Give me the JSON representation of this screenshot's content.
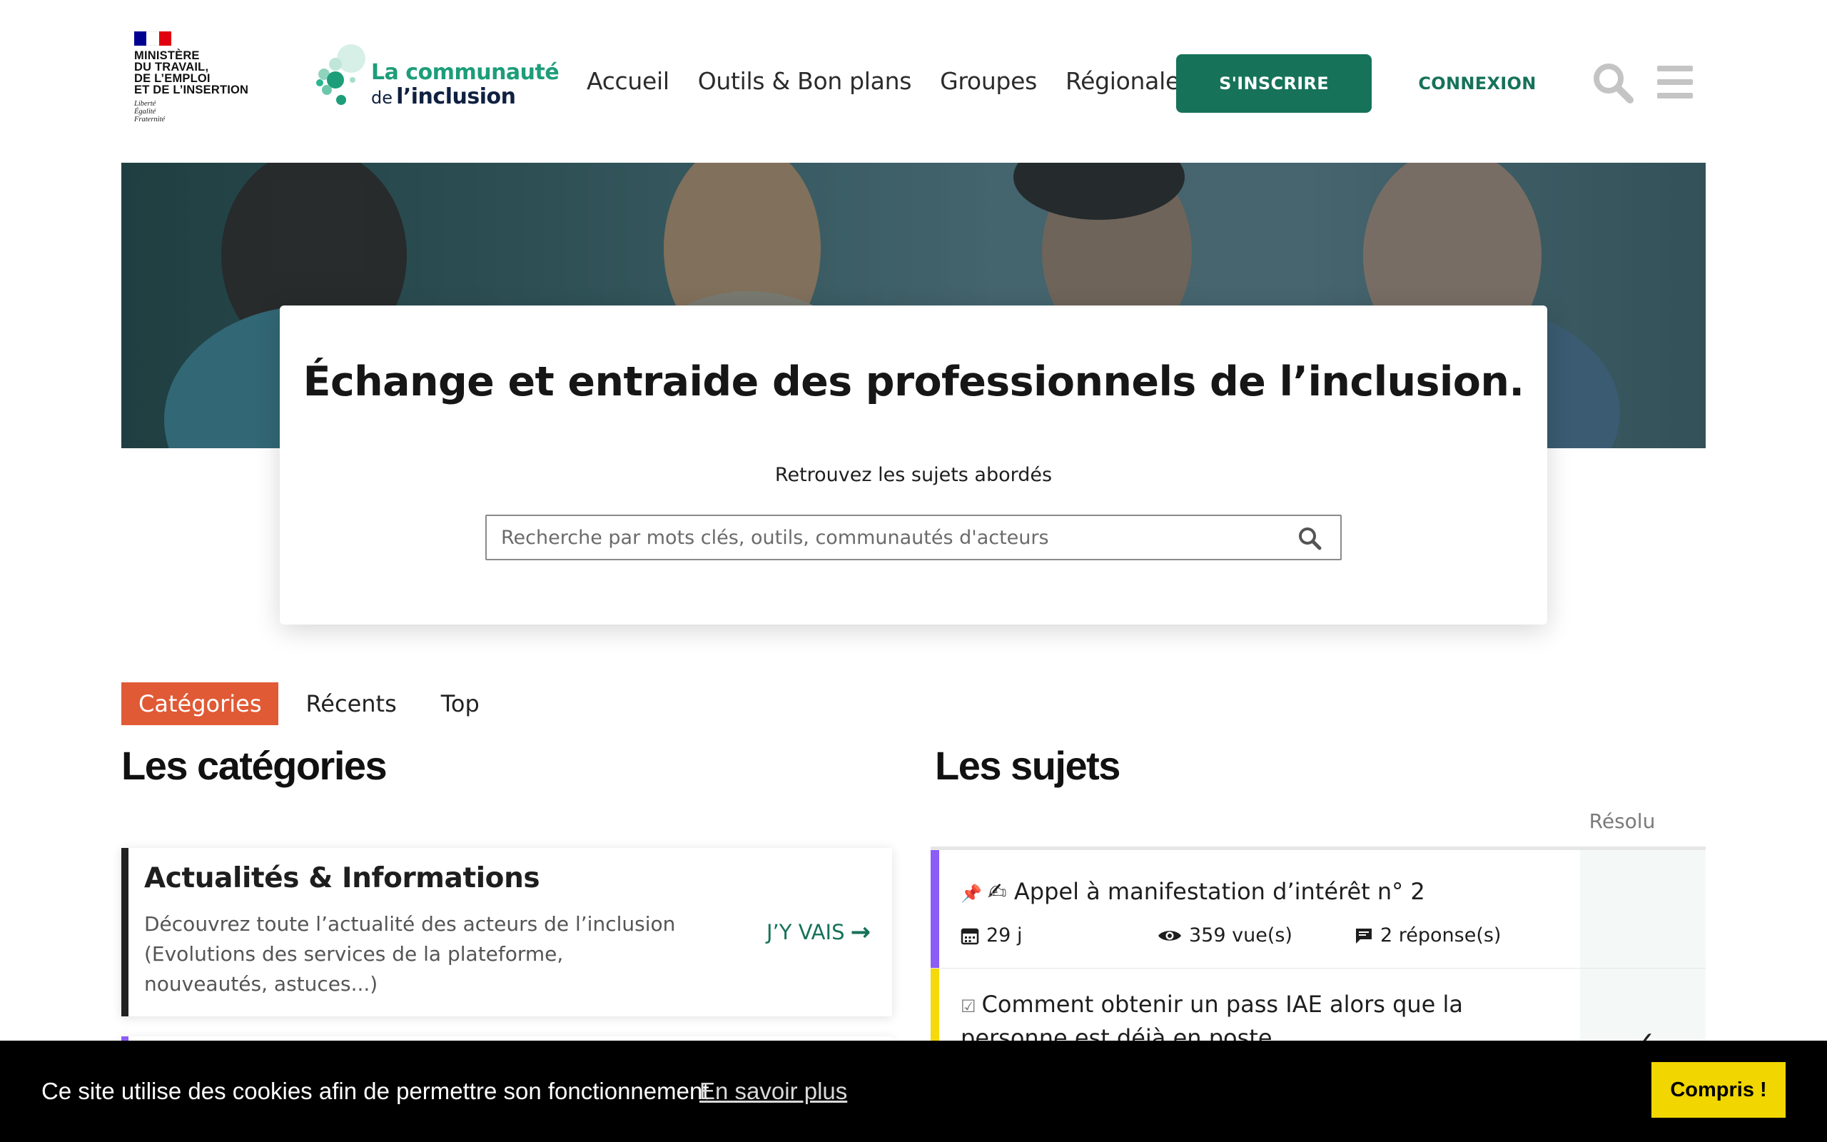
{
  "gov": {
    "lines": [
      "MINISTÈRE",
      "DU TRAVAIL,",
      "DE L’EMPLOI",
      "ET DE L’INSERTION"
    ],
    "motto": [
      "Liberté",
      "Égalité",
      "Fraternité"
    ]
  },
  "brand": {
    "line1": "La communauté",
    "line2_small": "de",
    "line2_big": "l’inclusion"
  },
  "nav": {
    "items": [
      "Accueil",
      "Outils & Bon plans",
      "Groupes",
      "Régionales"
    ],
    "signup": "S'INSCRIRE",
    "login": "CONNEXION"
  },
  "hero": {
    "title_regular": "Échange et entraide ",
    "title_bold": "des professionnels de l’inclusion",
    "title_end": ".",
    "subtitle": "Retrouvez les sujets abordés",
    "search_placeholder": "Recherche par mots clés, outils, communautés d'acteurs"
  },
  "tabs": [
    "Catégories",
    "Récents",
    "Top"
  ],
  "categories": {
    "heading": "Les catégories",
    "items": [
      {
        "title": "Actualités & Informations",
        "description": "Découvrez toute l’actualité des acteurs de l’inclusion (Evolutions des services de la plateforme, nouveautés, astuces...)",
        "link": "J’Y VAIS"
      }
    ]
  },
  "topics": {
    "heading": "Les sujets",
    "resolved_header": "Résolu",
    "items": [
      {
        "icon": "📌✍",
        "title": "Appel à manifestation d’intérêt n° 2",
        "age": "29 j",
        "views": "359 vue(s)",
        "replies": "2 réponse(s)"
      },
      {
        "icon": "☑",
        "title": "Comment obtenir un pass IAE alors que la personne est déjà en poste"
      }
    ]
  },
  "cookie": {
    "text": "Ce site utilise des cookies afin de permettre son fonctionnement",
    "link": "En savoir plus",
    "button": "Compris !"
  },
  "colors": {
    "brand_green": "#167259",
    "accent_orange": "#e05a35",
    "category_bar": "#222222",
    "topic_bar_1": "#8b5cf6",
    "topic_bar_2": "#f5d90a",
    "cookie_button": "#f1d600"
  }
}
